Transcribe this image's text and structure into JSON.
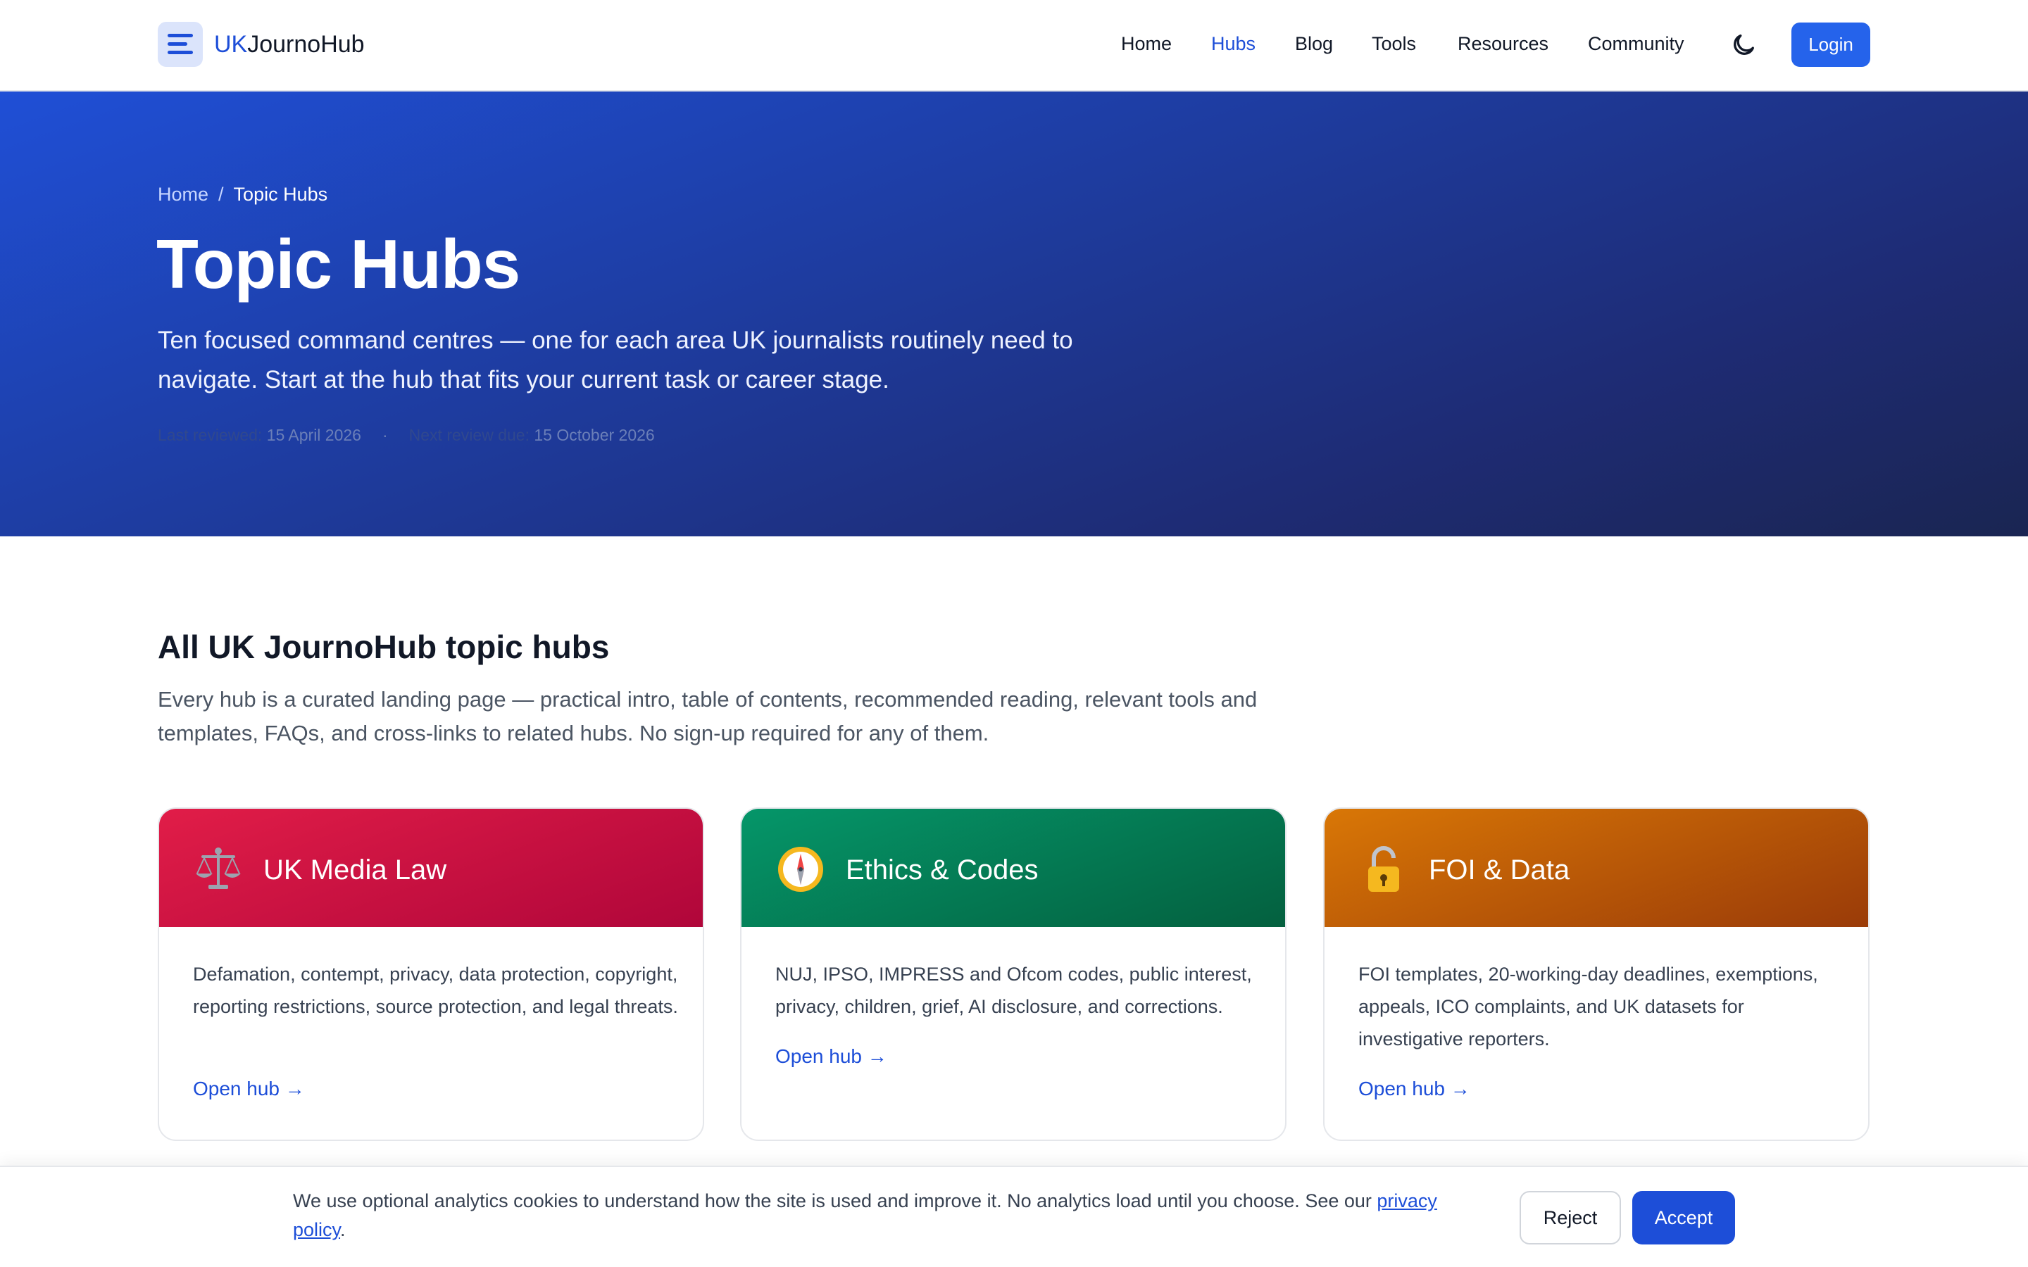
{
  "header": {
    "brand_accent": "UK",
    "brand_rest": "JournoHub",
    "nav": [
      {
        "label": "Home"
      },
      {
        "label": "Hubs",
        "active": true
      },
      {
        "label": "Blog"
      },
      {
        "label": "Tools"
      },
      {
        "label": "Resources"
      },
      {
        "label": "Community"
      }
    ],
    "theme_icon": "moon-icon",
    "menu_icon": "hamburger-icon",
    "login_label": "Login"
  },
  "hero": {
    "breadcrumb": {
      "home": "Home",
      "separator": "/",
      "current": "Topic Hubs"
    },
    "title": "Topic Hubs",
    "subtitle": "Ten focused command centres — one for each area UK journalists routinely need to navigate. Start at the hub that fits your current task or career stage.",
    "meta": {
      "reviewed_label": "Last reviewed:",
      "reviewed_date": "15 April 2026",
      "separator": "·",
      "next_label": "Next review due:",
      "next_date": "15 October 2026"
    }
  },
  "section": {
    "title": "All UK JournoHub topic hubs",
    "description": "Every hub is a curated landing page — practical intro, table of contents, recommended reading, relevant tools and templates, FAQs, and cross-links to related hubs. No sign-up required for any of them."
  },
  "cards": [
    {
      "title": "UK Media Law",
      "icon": "scales-icon",
      "description": "Defamation, contempt, privacy, data protection, copyright, reporting restrictions, source protection, and legal threats.",
      "link": "Open hub →",
      "color_from": "#e11d48",
      "color_to": "#b0063a"
    },
    {
      "title": "Ethics & Codes",
      "icon": "compass-icon",
      "description": "NUJ, IPSO, IMPRESS and Ofcom codes, public interest, privacy, children, grief, AI disclosure, and corrections.",
      "link": "Open hub →",
      "color_from": "#059669",
      "color_to": "#04603f"
    },
    {
      "title": "FOI & Data",
      "icon": "padlock-icon",
      "description": "FOI templates, 20-working-day deadlines, exemptions, appeals, ICO complaints, and UK datasets for investigative reporters.",
      "link": "Open hub →",
      "color_from": "#d97706",
      "color_to": "#9a3b08"
    }
  ],
  "cookie": {
    "text": "We use optional analytics cookies to understand how the site is used and improve it. No analytics load until you choose. See our ",
    "link": "privacy policy",
    "suffix": ".",
    "reject_label": "Reject",
    "accept_label": "Accept"
  }
}
